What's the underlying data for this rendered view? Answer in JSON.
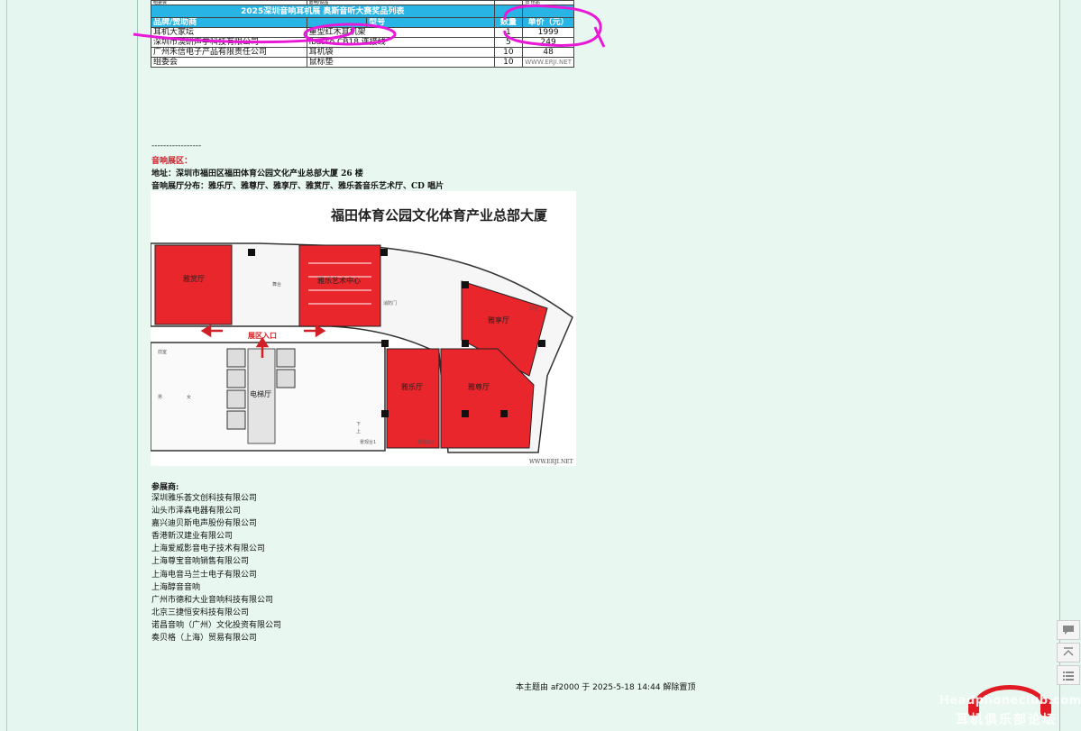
{
  "prize_table": {
    "top_row": [
      "组委会",
      "嘉明/设品",
      "",
      "旧 佳品"
    ],
    "title": "2025深圳音响耳机展 奥斯音听大赛奖品列表",
    "headers": [
      "品牌/赞助商",
      "",
      "型号",
      "数量",
      "单价（元）"
    ],
    "rows": [
      {
        "brand": "耳机大家坛",
        "item": "重型红木耳机架",
        "qty": "1",
        "price": "1999"
      },
      {
        "brand": "深圳市澳研声学科技有限公司",
        "item": "ibasso CB18 连接线",
        "qty": "5",
        "price": "249"
      },
      {
        "brand": "广州禾信电子产品有限责任公司",
        "item": "耳机袋",
        "qty": "10",
        "price": "48"
      },
      {
        "brand": "组委会",
        "item": "鼠标垫",
        "qty": "10",
        "price": "WWW.ERJI.NET"
      }
    ]
  },
  "section": {
    "separator": "-----------------",
    "title": "音响展区：",
    "address": "地址：深圳市福田区福田体育公园文化产业总部大厦 26 楼",
    "halls": "音响展厅分布：雅乐厅、雅尊厅、雅享厅、雅赏厅、雅乐荟音乐艺术厅、CD 唱片"
  },
  "map": {
    "title": "福田体育公园文化体育产业总部大厦",
    "rooms": [
      "雅赏厅",
      "雅乐艺术中心",
      "雅享厅",
      "雅乐厅",
      "雅尊厅",
      "电梯厅"
    ],
    "entrance": "展区入口",
    "watermark": "WWW.ERJI.NET",
    "minor_labels": [
      "舞台",
      "前室",
      "消防门",
      "阳台",
      "男",
      "女",
      "上",
      "下",
      "景观台1",
      "景观台2"
    ],
    "colors": {
      "hall": "#e8262b",
      "wall": "#222222",
      "arrow": "#d21f25"
    }
  },
  "exhibitors": {
    "title": "参展商:",
    "items": [
      "深圳雅乐荟文创科技有限公司",
      "汕头市泽森电器有限公司",
      "嘉兴迪贝斯电声股份有限公司",
      "香港新汉建业有限公司",
      "上海爱威影音电子技术有限公司",
      "上海尊宝音响销售有限公司",
      "上海电音马兰士电子有限公司",
      "上海醇音音响",
      "广州市德和大业音响科技有限公司",
      "北京三捷恒安科技有限公司",
      "诺昌音响（广州）文化投资有限公司",
      "奏贝格（上海）贸易有限公司"
    ]
  },
  "footer": {
    "text": "本主题由 af2000 于 2025-5-18 14:44 解除置顶"
  },
  "side_tools": [
    "comment-icon",
    "back-to-top-icon",
    "list-icon"
  ],
  "logo": {
    "en": "Headphoneclub.com",
    "cn": "耳机俱乐部论坛"
  }
}
